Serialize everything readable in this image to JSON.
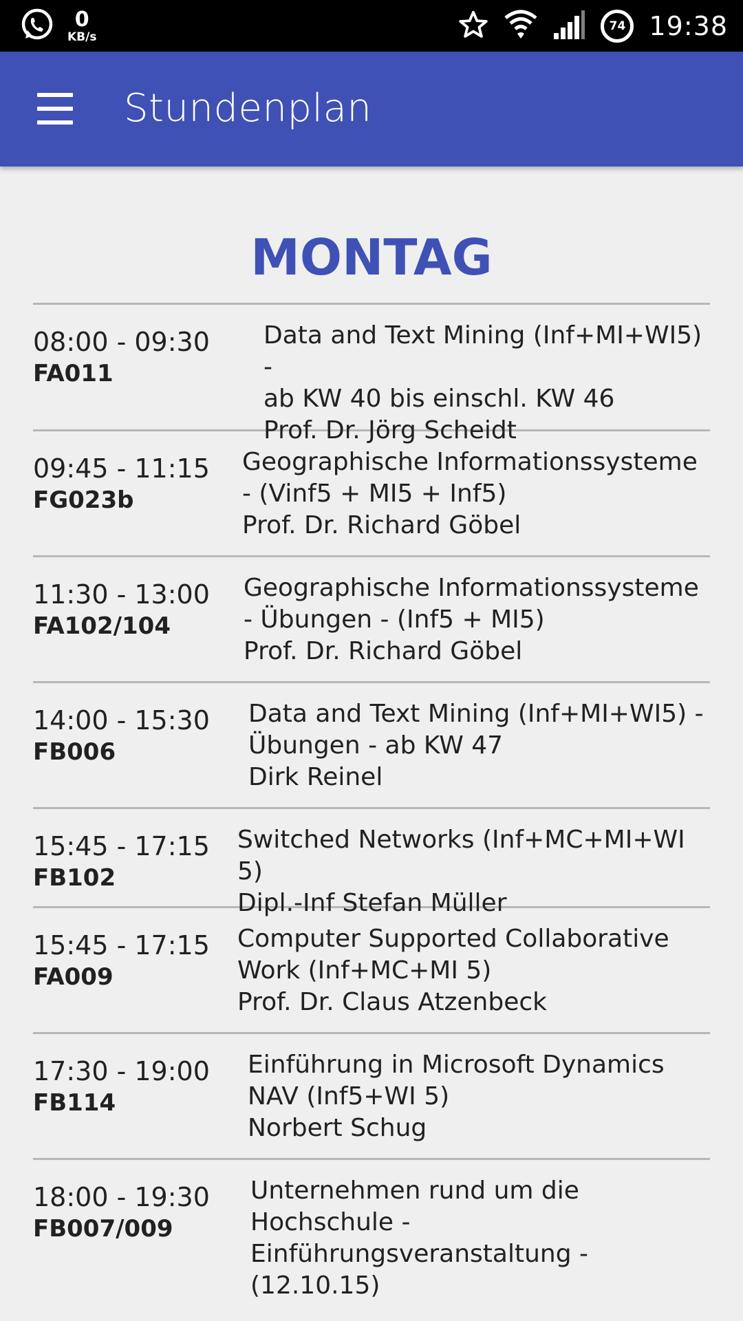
{
  "status_bar": {
    "speed_value": "0",
    "speed_unit": "KB/s",
    "battery": "74",
    "time": "19:38",
    "icons": [
      "whatsapp-icon",
      "star-icon",
      "wifi-icon",
      "signal-icon",
      "battery-icon"
    ]
  },
  "app_bar": {
    "title": "Stundenplan",
    "menu_icon": "hamburger-menu-icon",
    "color": "#3f51b5"
  },
  "day": "MONTAG",
  "entries": [
    {
      "time": "08:00 - 09:30",
      "room": "FA011",
      "lines": [
        "Data and Text Mining (Inf+MI+WI5) -",
        "ab KW 40 bis einschl. KW 46",
        "Prof. Dr. Jörg Scheidt"
      ]
    },
    {
      "time": "09:45 - 11:15",
      "room": "FG023b",
      "lines": [
        "Geographische Informationssysteme",
        "- (Vinf5 + MI5 + Inf5)",
        "Prof. Dr. Richard Göbel"
      ]
    },
    {
      "time": "11:30 - 13:00",
      "room": "FA102/104",
      "lines": [
        "Geographische Informationssysteme",
        "- Übungen - (Inf5 + MI5)",
        "Prof. Dr. Richard Göbel"
      ]
    },
    {
      "time": "14:00 - 15:30",
      "room": "FB006",
      "lines": [
        "Data and Text Mining (Inf+MI+WI5) -",
        "Übungen - ab KW 47",
        "Dirk Reinel"
      ]
    },
    {
      "time": "15:45 - 17:15",
      "room": "FB102",
      "lines": [
        "Switched Networks (Inf+MC+MI+WI 5)",
        "Dipl.-Inf Stefan Müller"
      ]
    },
    {
      "time": "15:45 - 17:15",
      "room": "FA009",
      "lines": [
        "Computer Supported Collaborative",
        "Work (Inf+MC+MI 5)",
        "Prof. Dr. Claus Atzenbeck"
      ]
    },
    {
      "time": "17:30 - 19:00",
      "room": "FB114",
      "lines": [
        "Einführung in Microsoft Dynamics",
        "NAV (Inf5+WI 5)",
        "Norbert Schug"
      ]
    },
    {
      "time": "18:00 - 19:30",
      "room": "FB007/009",
      "lines": [
        "Unternehmen rund um die",
        "Hochschule -",
        "Einführungsveranstaltung - (12.10.15)"
      ]
    }
  ]
}
